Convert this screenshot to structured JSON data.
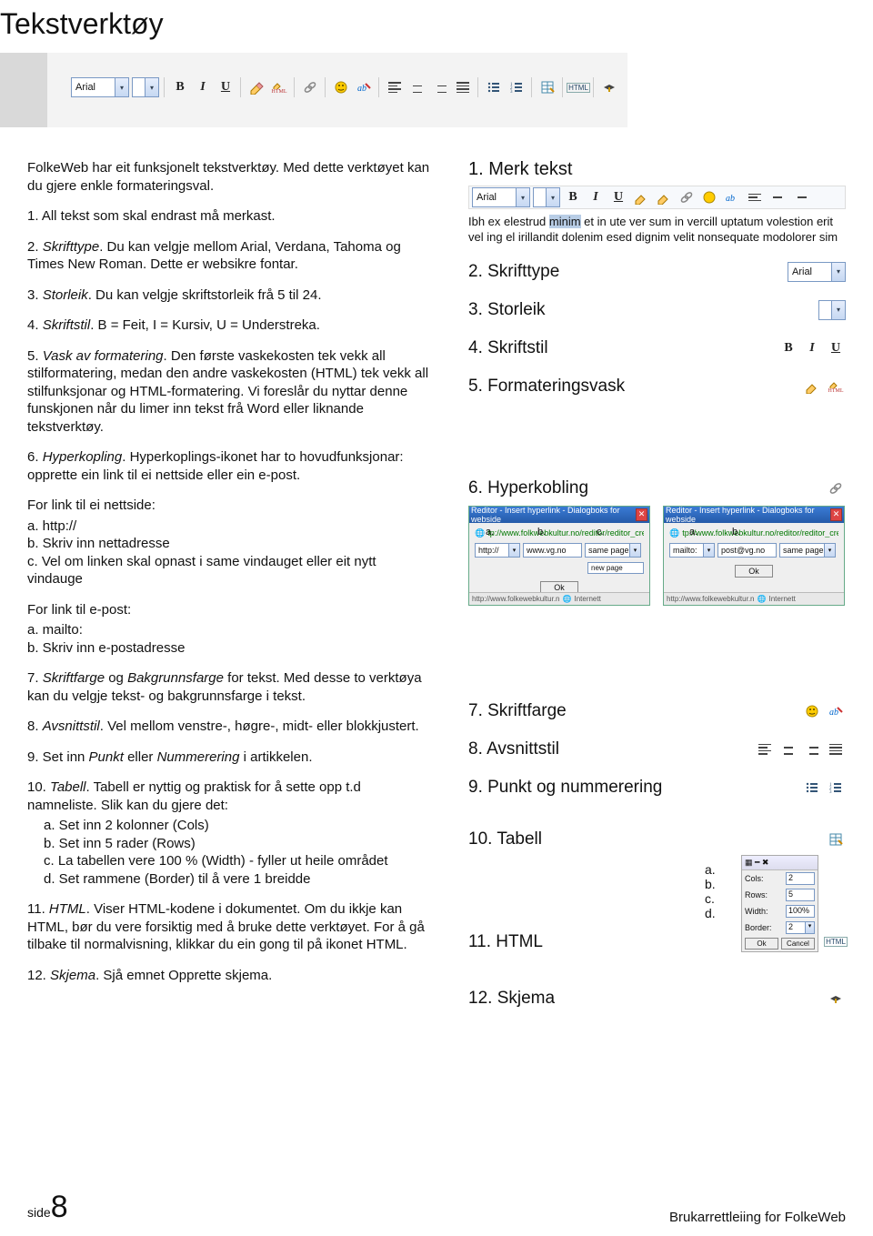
{
  "title": "Tekstverktøy",
  "toolbar": {
    "font": "Arial",
    "bold": "B",
    "italic": "I",
    "underline": "U",
    "html": "HTML"
  },
  "intro": "FolkeWeb har eit funksjonelt tekstverktøy. Med dette verktøyet kan du gjere enkle formateringsval.",
  "points": {
    "p1": "1. All tekst som skal endrast må merkast.",
    "p2a": "2. ",
    "p2i": "Skrifttype",
    "p2b": ". Du kan velgje mellom Arial, Verdana, Tahoma og Times New Roman. Dette er websikre fontar.",
    "p3a": "3. ",
    "p3i": "Storleik",
    "p3b": ". Du kan velgje skriftstorleik frå 5 til 24.",
    "p4a": "4. ",
    "p4i": "Skriftstil",
    "p4b": ". B = Feit, I = Kursiv, U = Understreka.",
    "p5a": "5. ",
    "p5i": "Vask av formatering",
    "p5b": ". Den første vaskekosten tek vekk all stilformatering, medan den andre vaskekosten (HTML) tek vekk all stilfunksjonar og HTML-formatering. Vi foreslår du nyttar denne funskjonen når du limer inn tekst frå Word eller liknande tekstverktøy.",
    "p6a": "6. ",
    "p6i": "Hyperkopling",
    "p6b": ". Hyperkoplings-ikonet har to hovudfunksjonar: opprette ein link til ei nettside eller ein e-post.",
    "linkweb_head": "For link til ei nettside:",
    "linkweb_a": "a. http://",
    "linkweb_b": "b. Skriv inn nettadresse",
    "linkweb_c": "c. Vel om linken skal opnast i same vindauget eller eit nytt vindauge",
    "linkmail_head": "For link til e-post:",
    "linkmail_a": "a. mailto:",
    "linkmail_b": "b. Skriv inn e-postadresse",
    "p7a": "7. ",
    "p7i": "Skriftfarge",
    "p7j": "Bakgrunnsfarge",
    "p7mid": " og ",
    "p7b": " for tekst. Med desse to verktøya kan du velgje tekst- og bakgrunnsfarge i tekst.",
    "p8a": "8. ",
    "p8i": "Avsnittstil",
    "p8b": ". Vel mellom venstre-, høgre-, midt- eller blokkjustert.",
    "p9a": "9. Set inn ",
    "p9i": "Punkt",
    "p9mid": " eller ",
    "p9j": "Nummerering",
    "p9b": " i artikkelen.",
    "p10a": "10. ",
    "p10i": "Tabell",
    "p10b": ". Tabell er nyttig og praktisk for å sette opp t.d namneliste. Slik kan du gjere det:",
    "p10_a": "a. Set inn 2 kolonner (Cols)",
    "p10_b": "b. Set inn 5 rader (Rows)",
    "p10_c": "c. La tabellen vere 100 % (Width) - fyller ut heile området",
    "p10_d": "d. Set rammene (Border) til å vere 1 breidde",
    "p11a": "11. ",
    "p11i": "HTML",
    "p11b": ". Viser HTML-kodene i dokumentet. Om du ikkje kan HTML, bør du vere forsiktig med å bruke dette verktøyet. For å gå tilbake til normalvisning, klikkar du ein gong til på ikonet HTML.",
    "p12a": "12. ",
    "p12i": "Skjema",
    "p12b": ". Sjå emnet Opprette skjema."
  },
  "right": {
    "h1": "1. Merk tekst",
    "sample_a": "Ibh ex elestrud ",
    "sample_hl": "minim",
    "sample_b": " et in ute ver sum in vercill uptatum volestion erit vel ing el irillandit dolenim esed dignim velit nonsequate modolorer sim",
    "r2": "2. Skrifttype",
    "r3": "3. Storleik",
    "r4": "4. Skriftstil",
    "r5": "5. Formateringsvask",
    "r6": "6. Hyperkobling",
    "r7": "7. Skriftfarge",
    "r8": "8. Avsnittstil",
    "r9": "9. Punkt og nummerering",
    "r10": "10. Tabell",
    "r11": "11. HTML",
    "r12": "12. Skjema",
    "font_demo": "Arial"
  },
  "dlg1": {
    "title": "Reditor - Insert hyperlink - Dialogboks for webside",
    "protocol": "http://",
    "url": "www.vg.no",
    "target1": "same page",
    "target2": "new page",
    "ok": "Ok",
    "status": "http://www.folkewebkultur.n",
    "statusnet": "Internett",
    "addr": "tp://www.folkwebkultur.no/reditor/reditor_createlink.html"
  },
  "dlg2": {
    "title": "Reditor - Insert hyperlink - Dialogboks for webside",
    "protocol": "mailto:",
    "url": "post@vg.no",
    "target1": "same page",
    "ok": "Ok",
    "status": "http://www.folkewebkultur.n",
    "statusnet": "Internett",
    "addr": "tp://www.folkwebkultur.no/reditor/reditor_createlink.html"
  },
  "table_dlg": {
    "cols_l": "Cols:",
    "cols_v": "2",
    "rows_l": "Rows:",
    "rows_v": "5",
    "width_l": "Width:",
    "width_v": "100%",
    "border_l": "Border:",
    "border_v": "2",
    "ok": "Ok",
    "cancel": "Cancel"
  },
  "abcd": {
    "a": "a.",
    "b": "b.",
    "c": "c.",
    "d": "d."
  },
  "footer": {
    "side": "side",
    "num": "8",
    "prod": "Brukarrettleiing for FolkeWeb"
  }
}
